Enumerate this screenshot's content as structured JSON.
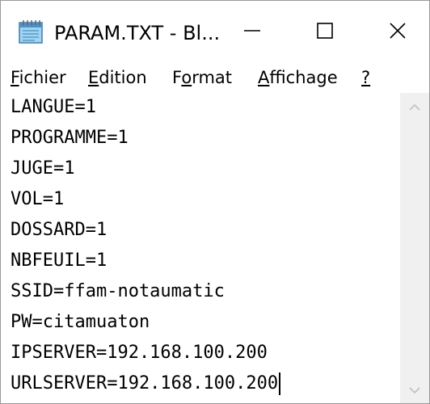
{
  "window": {
    "title": "PARAM.TXT - Bl...",
    "icon": "notepad-icon",
    "buttons": {
      "minimize": "minimize-icon",
      "maximize": "maximize-icon",
      "close": "close-icon"
    }
  },
  "menu": {
    "items": [
      {
        "mnemonic": "F",
        "rest": "ichier"
      },
      {
        "mnemonic": "E",
        "rest": "dition"
      },
      {
        "pre": "F",
        "mnemonic": "o",
        "rest": "rmat"
      },
      {
        "mnemonic": "A",
        "rest": "ffichage"
      },
      {
        "mnemonic": "?",
        "rest": ""
      }
    ]
  },
  "document": {
    "lines": [
      "LANGUE=1",
      "PROGRAMME=1",
      "JUGE=1",
      "VOL=1",
      "DOSSARD=1",
      "NBFEUIL=1",
      "SSID=ffam-notaumatic",
      "PW=citamuaton",
      "IPSERVER=192.168.100.200",
      "URLSERVER=192.168.100.200"
    ]
  },
  "colors": {
    "text": "#000000",
    "scrollbar_track": "#f0f0f0",
    "scroll_arrow": "#c0c0c0",
    "border": "#9a9a9a"
  }
}
